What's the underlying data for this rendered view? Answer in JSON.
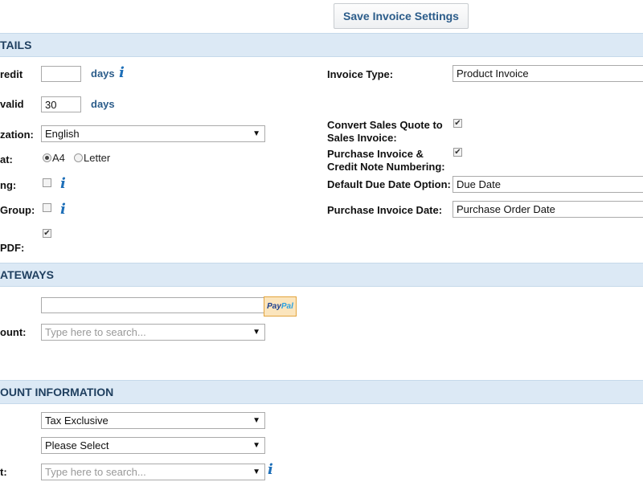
{
  "toolbar": {
    "save_label": "Save Invoice Settings"
  },
  "sections": {
    "details": "TAILS",
    "gateways": "ATEWAYS",
    "account": "OUNT INFORMATION"
  },
  "left": {
    "credit_label": "redit",
    "credit_value": "",
    "days": "days",
    "valid_label": "valid",
    "valid_value": "30",
    "localization_label": "zation:",
    "localization_value": "English",
    "format_label": "at:",
    "format_a4": "A4",
    "format_letter": "Letter",
    "ng_label": "ng:",
    "group_label": "Group:",
    "pdf_label": "PDF:"
  },
  "right": {
    "invoice_type_label": "Invoice Type:",
    "invoice_type_value": "Product Invoice",
    "convert_label_1": "Convert Sales Quote to",
    "convert_label_2": "Sales Invoice:",
    "purchase_numbering_label_1": "Purchase Invoice &",
    "purchase_numbering_label_2": "Credit Note Numbering:",
    "due_date_label": "Default Due Date Option:",
    "due_date_value": "Due Date",
    "purchase_date_label": "Purchase Invoice Date:",
    "purchase_date_value": "Purchase Order Date"
  },
  "gateways": {
    "paypal_value": "",
    "paypal_logo_1": "Pay",
    "paypal_logo_2": "Pal",
    "account_label": "ount:",
    "account_placeholder": "Type here to search..."
  },
  "account": {
    "tax_value": "Tax Exclusive",
    "select_value": "Please Select",
    "t_label": "t:",
    "search_placeholder": "Type here to search..."
  },
  "checks": {
    "ng": false,
    "group": false,
    "pdf": true,
    "convert": true,
    "purchase_numbering": true
  },
  "colors": {
    "accent": "#2b5c8a",
    "band": "#dce9f5",
    "info": "#1e6fb8"
  }
}
